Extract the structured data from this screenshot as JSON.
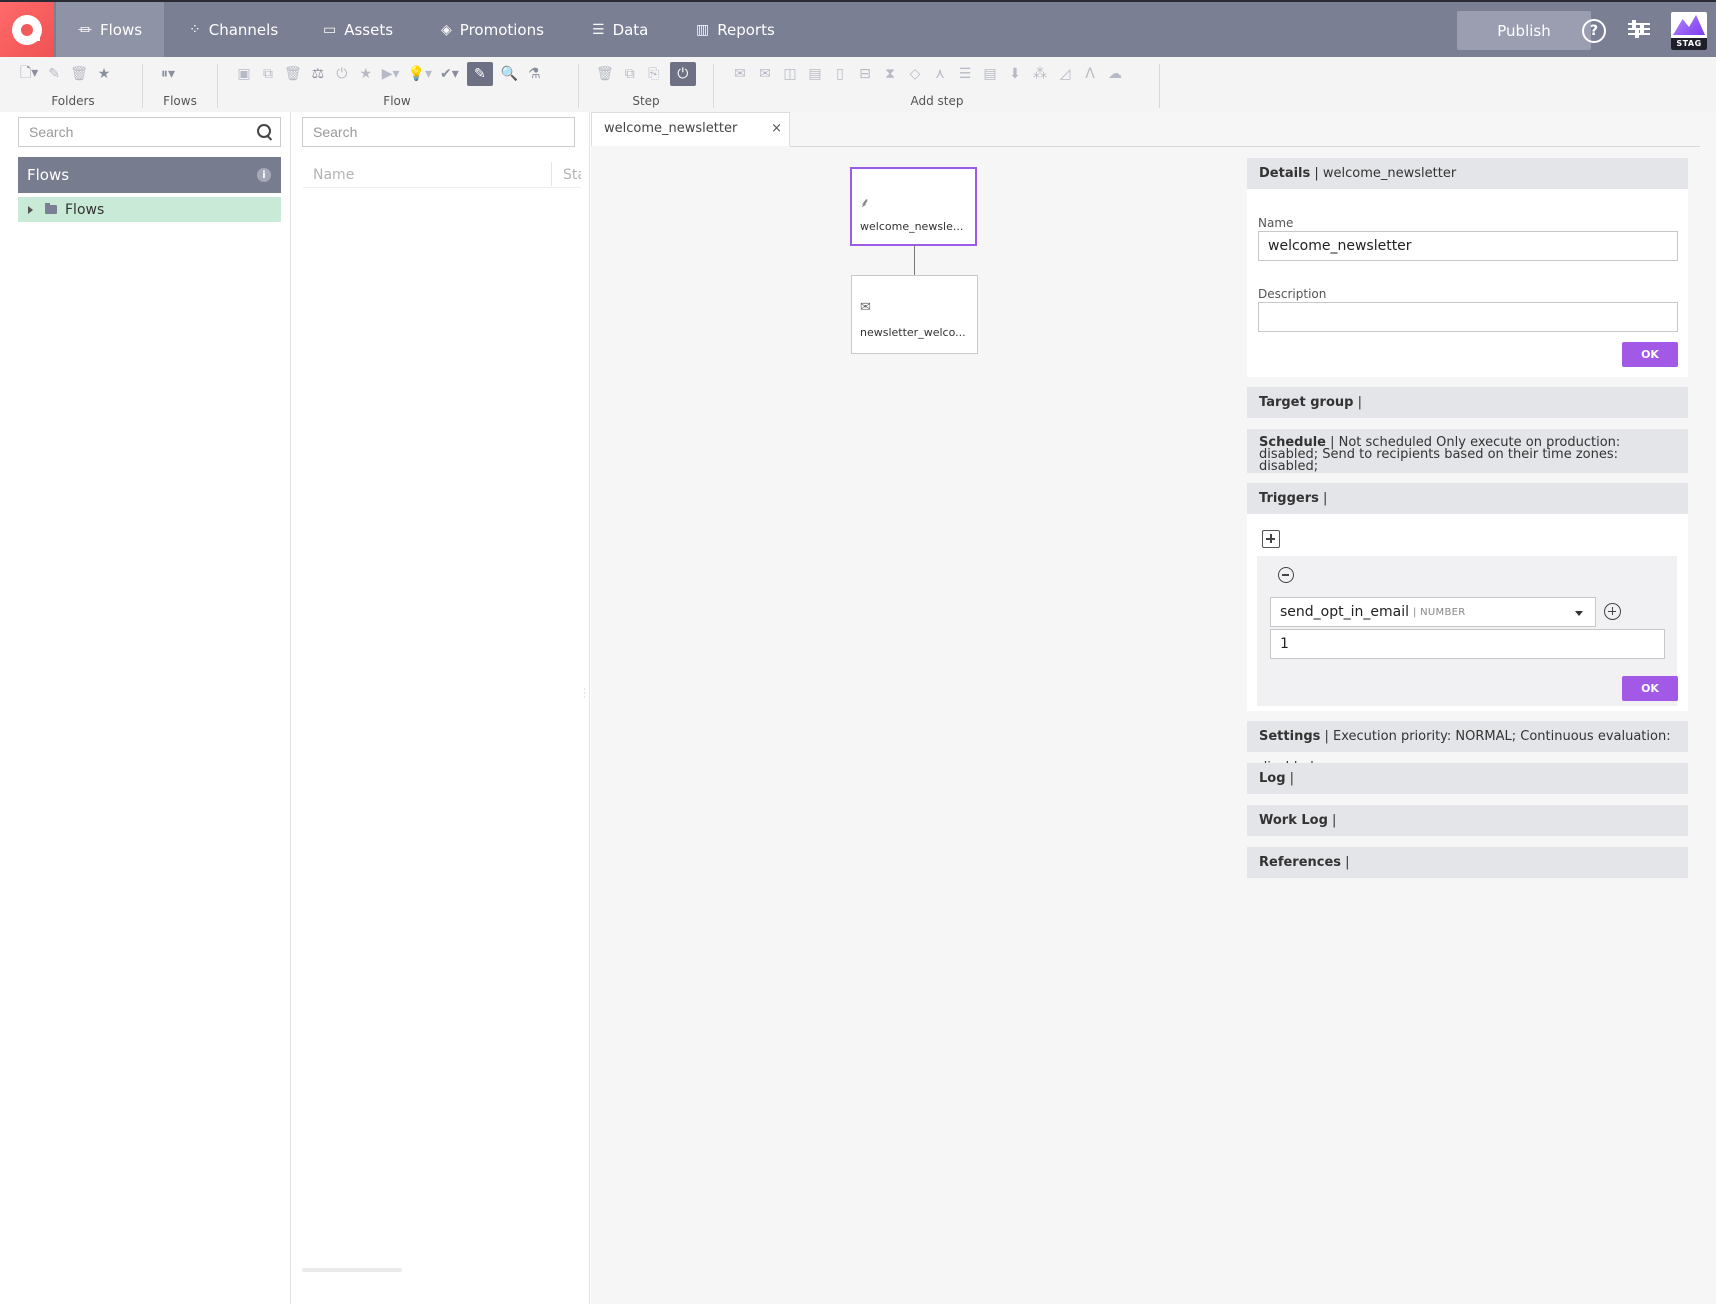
{
  "nav": {
    "tabs": [
      {
        "label": "Flows",
        "icon": "flow-icon"
      },
      {
        "label": "Channels",
        "icon": "channels-icon"
      },
      {
        "label": "Assets",
        "icon": "assets-icon"
      },
      {
        "label": "Promotions",
        "icon": "promotions-icon"
      },
      {
        "label": "Data",
        "icon": "database-icon"
      },
      {
        "label": "Reports",
        "icon": "bar-chart-icon"
      }
    ],
    "publish_label": "Publish",
    "help_glyph": "?",
    "env_badge": "STAG"
  },
  "toolbar": {
    "groups": [
      {
        "label": "Folders"
      },
      {
        "label": "Flows"
      },
      {
        "label": "Flow"
      },
      {
        "label": "Step"
      },
      {
        "label": "Add step"
      }
    ]
  },
  "left": {
    "search_placeholder": "Search",
    "header": "Flows",
    "info_glyph": "i",
    "tree": [
      {
        "label": "Flows"
      }
    ]
  },
  "list": {
    "search_placeholder": "Search",
    "columns": [
      "Name",
      "Status"
    ]
  },
  "editor": {
    "tab_label": "welcome_newsletter",
    "close_glyph": "×",
    "nodes": [
      {
        "label": "welcome_newsle...",
        "icon": "hierarchy-icon",
        "selected": true
      },
      {
        "label": "newsletter_welco...",
        "icon": "mail-icon",
        "selected": false
      }
    ]
  },
  "details": {
    "header_bold": "Details",
    "header_rest": " | welcome_newsletter",
    "name_label": "Name",
    "name_value": "welcome_newsletter",
    "description_label": "Description",
    "description_value": "",
    "ok_label": "OK"
  },
  "sections": {
    "target_group": {
      "bold": "Target group",
      "rest": " |"
    },
    "schedule": {
      "bold": "Schedule",
      "rest": " | Not scheduled Only execute on production: disabled; Send to recipients based on their time zones: disabled;"
    },
    "triggers": {
      "bold": "Triggers",
      "rest": " |"
    },
    "settings": {
      "bold": "Settings",
      "rest": " | Execution priority: NORMAL; Continuous evaluation: disabled"
    },
    "log": {
      "bold": "Log",
      "rest": " |"
    },
    "work_log": {
      "bold": "Work Log",
      "rest": " |"
    },
    "references": {
      "bold": "References",
      "rest": " |"
    }
  },
  "triggers": {
    "field_name": "send_opt_in_email",
    "field_type": "| NUMBER",
    "value": "1",
    "ok_label": "OK"
  },
  "colors": {
    "nav_bg": "#7a7f94",
    "accent": "#a259e6",
    "tree_selected": "#c9ead6"
  }
}
